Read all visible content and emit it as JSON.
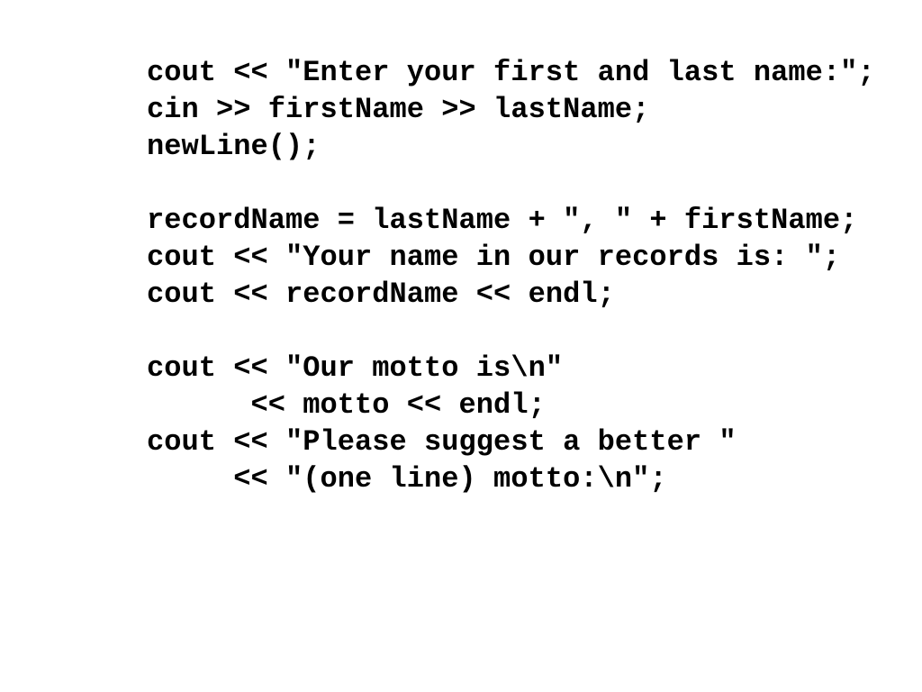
{
  "slide": {
    "background_color": "#ffffff",
    "text_color": "#000000",
    "kind": "code-listing",
    "language": "C++"
  },
  "code": {
    "lines": [
      "cout << \"Enter your first and last name:\";",
      "cin >> firstName >> lastName;",
      "newLine();",
      "",
      "recordName = lastName + \", \" + firstName;",
      "cout << \"Your name in our records is: \";",
      "cout << recordName << endl;",
      "",
      "cout << \"Our motto is\\n\"",
      "      << motto << endl;",
      "cout << \"Please suggest a better \"",
      "     << \"(one line) motto:\\n\";"
    ]
  }
}
